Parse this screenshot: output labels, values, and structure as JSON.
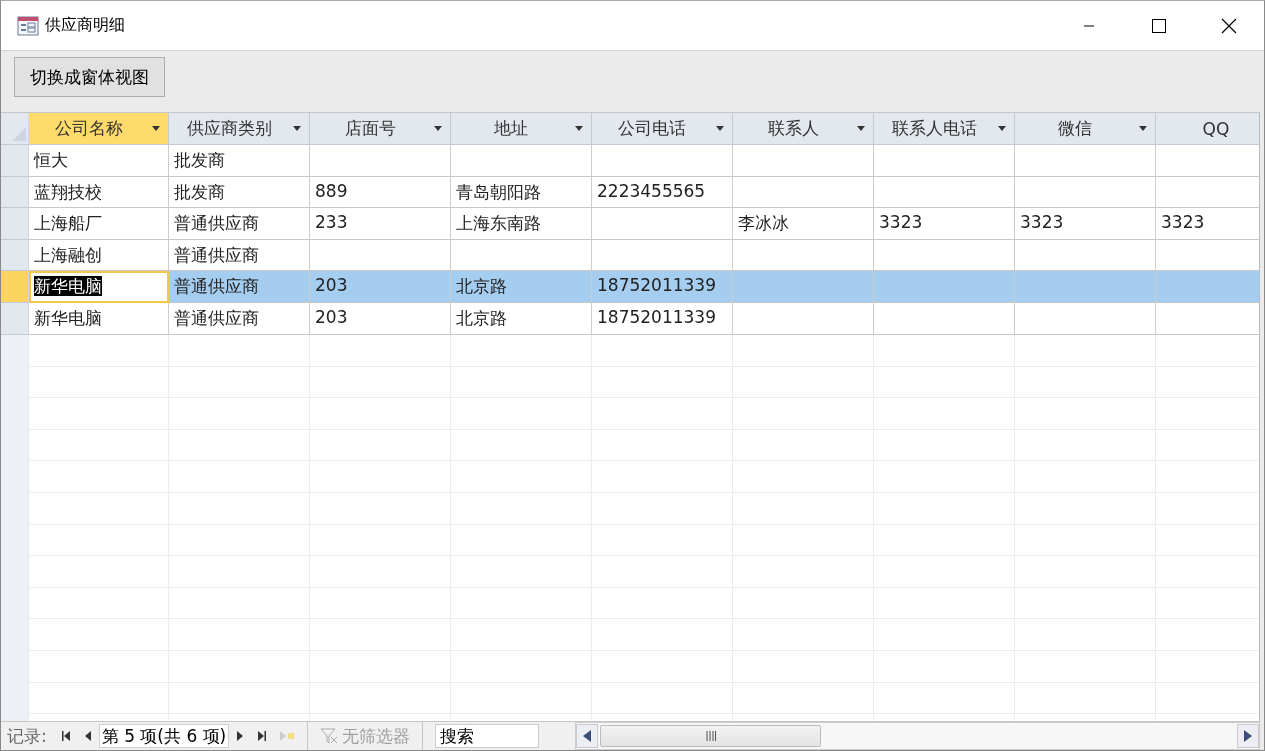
{
  "window": {
    "title": "供应商明细"
  },
  "toolbar": {
    "buttons": [
      "切换成窗体视图"
    ]
  },
  "table": {
    "columns": [
      {
        "label": "公司名称",
        "selected": true,
        "menu": true
      },
      {
        "label": "供应商类别",
        "selected": false,
        "menu": true
      },
      {
        "label": "店面号",
        "selected": false,
        "menu": true
      },
      {
        "label": "地址",
        "selected": false,
        "menu": true
      },
      {
        "label": "公司电话",
        "selected": false,
        "menu": true
      },
      {
        "label": "联系人",
        "selected": false,
        "menu": true
      },
      {
        "label": "联系人电话",
        "selected": false,
        "menu": true
      },
      {
        "label": "微信",
        "selected": false,
        "menu": true
      },
      {
        "label": "QQ",
        "selected": false,
        "menu": false
      }
    ],
    "rows": [
      {
        "selected": false,
        "cells": [
          "恒大",
          "批发商",
          "",
          "",
          "",
          "",
          "",
          "",
          ""
        ]
      },
      {
        "selected": false,
        "cells": [
          "蓝翔技校",
          "批发商",
          "889",
          "青岛朝阳路",
          "2223455565",
          "",
          "",
          "",
          ""
        ]
      },
      {
        "selected": false,
        "cells": [
          "上海船厂",
          "普通供应商",
          "233",
          "上海东南路",
          "",
          "李冰冰",
          "3323",
          "3323",
          "3323"
        ]
      },
      {
        "selected": false,
        "cells": [
          "上海融创",
          "普通供应商",
          "",
          "",
          "",
          "",
          "",
          "",
          ""
        ]
      },
      {
        "selected": true,
        "cells": [
          "新华电脑",
          "普通供应商",
          "203",
          "北京路",
          "18752011339",
          "",
          "",
          "",
          ""
        ]
      },
      {
        "selected": false,
        "cells": [
          "新华电脑",
          "普通供应商",
          "203",
          "北京路",
          "18752011339",
          "",
          "",
          "",
          ""
        ]
      }
    ]
  },
  "navigation": {
    "label": "记录:",
    "position": "第 5 项(共 6 项)",
    "filter": {
      "label": "无筛选器",
      "disabled": true
    },
    "search": {
      "placeholder": "搜索"
    }
  }
}
